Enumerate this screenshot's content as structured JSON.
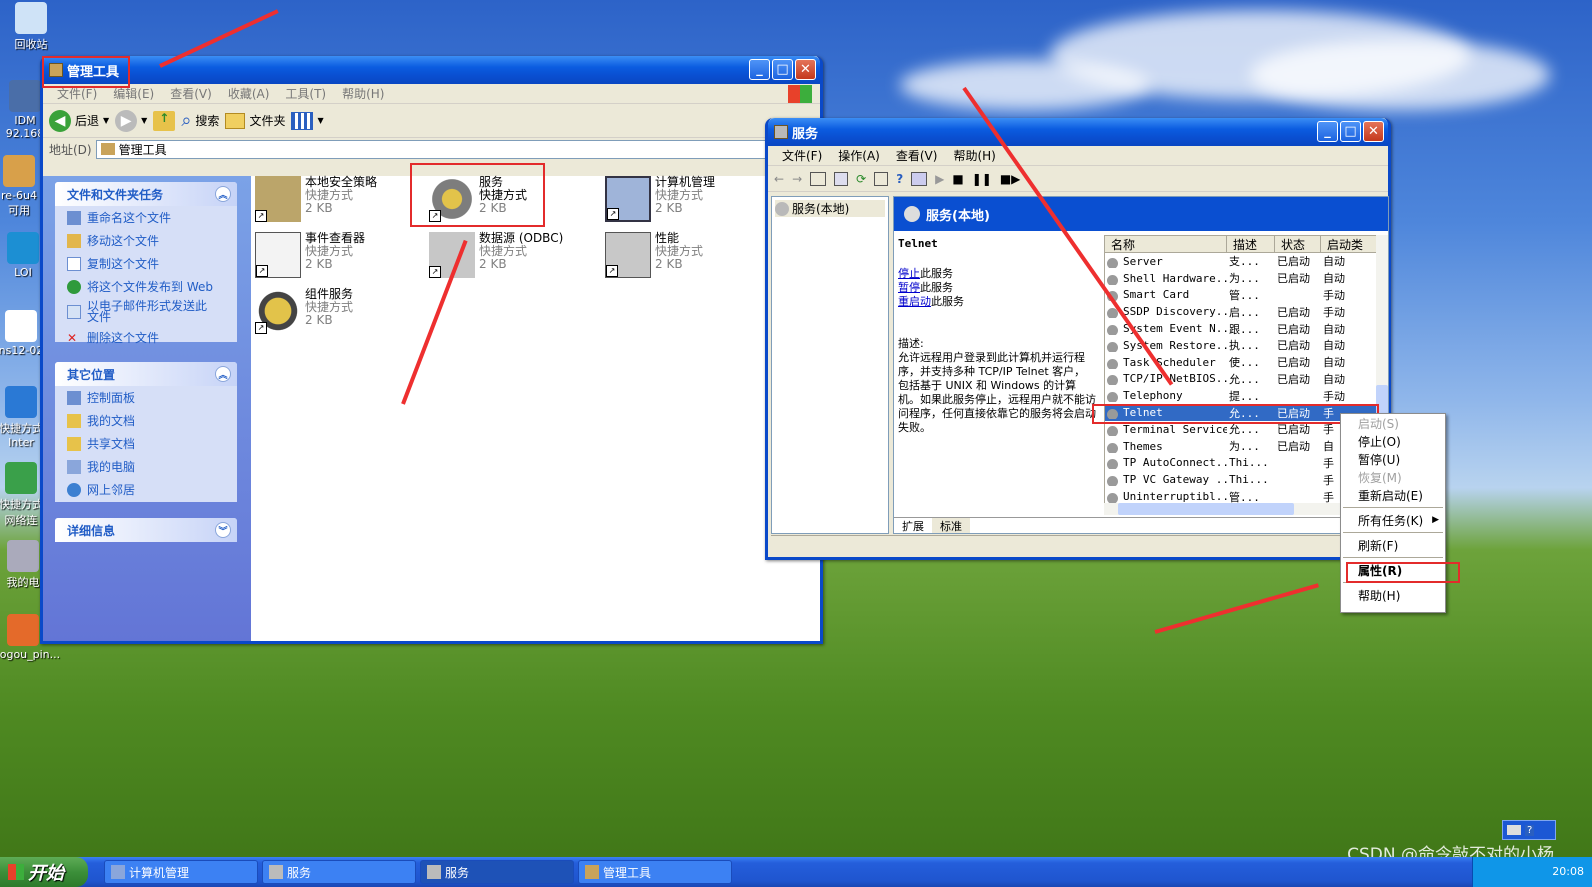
{
  "desktop": {
    "icons": [
      "回收站",
      "IDM\n92.168",
      "re-6u4\n可用",
      "LOI",
      "ns12-02",
      "快捷方式\nInter",
      "快捷方式\n网络连",
      "我的电",
      "sogou_pin..."
    ],
    "watermark": "CSDN @命令敲不对的小杨"
  },
  "admin": {
    "title": "管理工具",
    "menu": [
      "文件(F)",
      "编辑(E)",
      "查看(V)",
      "收藏(A)",
      "工具(T)",
      "帮助(H)"
    ],
    "toolbar": {
      "back": "后退",
      "search": "搜索",
      "folders": "文件夹"
    },
    "address_label": "地址(D)",
    "address_value": "管理工具",
    "panel1": {
      "title": "文件和文件夹任务",
      "items": [
        "重命名这个文件",
        "移动这个文件",
        "复制这个文件",
        "将这个文件发布到 Web",
        "以电子邮件形式发送此文件",
        "删除这个文件"
      ]
    },
    "panel2": {
      "title": "其它位置",
      "items": [
        "控制面板",
        "我的文档",
        "共享文档",
        "我的电脑",
        "网上邻居"
      ]
    },
    "panel3": {
      "title": "详细信息"
    },
    "files": [
      {
        "name": "本地安全策略",
        "type": "快捷方式",
        "size": "2 KB"
      },
      {
        "name": "服务",
        "type": "快捷方式",
        "size": "2 KB"
      },
      {
        "name": "计算机管理",
        "type": "快捷方式",
        "size": "2 KB"
      },
      {
        "name": "事件查看器",
        "type": "快捷方式",
        "size": "2 KB"
      },
      {
        "name": "数据源 (ODBC)",
        "type": "快捷方式",
        "size": "2 KB"
      },
      {
        "name": "性能",
        "type": "快捷方式",
        "size": "2 KB"
      },
      {
        "name": "组件服务",
        "type": "快捷方式",
        "size": "2 KB"
      }
    ]
  },
  "services": {
    "title": "服务",
    "menu": [
      "文件(F)",
      "操作(A)",
      "查看(V)",
      "帮助(H)"
    ],
    "tree_item": "服务(本地)",
    "header": "服务(本地)",
    "selected_name": "Telnet",
    "links": [
      [
        "停止",
        "此服务"
      ],
      [
        "暂停",
        "此服务"
      ],
      [
        "重启动",
        "此服务"
      ]
    ],
    "desc_label": "描述:",
    "desc": "允许远程用户登录到此计算机并运行程序，并支持多种 TCP/IP Telnet 客户，包括基于 UNIX 和 Windows 的计算机。如果此服务停止，远程用户就不能访问程序，任何直接依靠它的服务将会启动失败。",
    "columns": [
      "名称",
      "描述",
      "状态",
      "启动类"
    ],
    "rows": [
      [
        "Server",
        "支...",
        "已启动",
        "自动"
      ],
      [
        "Shell Hardware...",
        "为...",
        "已启动",
        "自动"
      ],
      [
        "Smart Card",
        "管...",
        "",
        "手动"
      ],
      [
        "SSDP Discovery...",
        "启...",
        "已启动",
        "手动"
      ],
      [
        "System Event N...",
        "跟...",
        "已启动",
        "自动"
      ],
      [
        "System Restore...",
        "执...",
        "已启动",
        "自动"
      ],
      [
        "Task Scheduler",
        "使...",
        "已启动",
        "自动"
      ],
      [
        "TCP/IP NetBIOS...",
        "允...",
        "已启动",
        "自动"
      ],
      [
        "Telephony",
        "提...",
        "",
        "手动"
      ],
      [
        "Telnet",
        "允...",
        "已启动",
        "手"
      ],
      [
        "Terminal Services",
        "允...",
        "已启动",
        "手"
      ],
      [
        "Themes",
        "为...",
        "已启动",
        "自"
      ],
      [
        "TP AutoConnect...",
        "Thi...",
        "",
        "手"
      ],
      [
        "TP VC Gateway ...",
        "Thi...",
        "",
        "手"
      ],
      [
        "Uninterruptibl...",
        "管...",
        "",
        "手"
      ]
    ],
    "tabs": [
      "扩展",
      "标准"
    ]
  },
  "context_menu": {
    "items": [
      "启动(S)",
      "停止(O)",
      "暂停(U)",
      "恢复(M)",
      "重新启动(E)",
      "所有任务(K)",
      "刷新(F)",
      "属性(R)",
      "帮助(H)"
    ],
    "disabled": [
      0,
      3
    ]
  },
  "taskbar": {
    "start": "开始",
    "buttons": [
      "计算机管理",
      "服务",
      "服务",
      "管理工具"
    ],
    "clock": "20:08"
  }
}
